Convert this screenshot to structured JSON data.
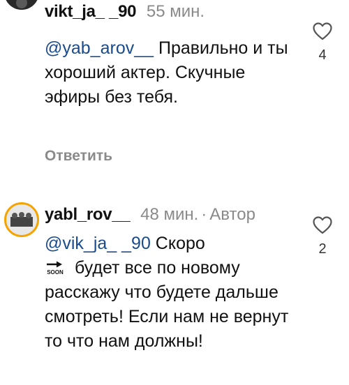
{
  "comments": [
    {
      "username": "vikt_ja_ _90",
      "time": "55 мин.",
      "mention": "@yab_arov__",
      "text": " Правильно и ты хороший актер. Скучные эфиры без тебя.",
      "reply_label": "Ответить",
      "likes": "4"
    },
    {
      "username": "yabl_rov__",
      "time": "48 мин.",
      "separator": "·",
      "author_label": "Автор",
      "mention": "@vik_ja_ _90",
      "text_part1": " Скоро ",
      "soon_label": "SOON",
      "text_part2": " будет все по новому расскажу что будете дальше смотреть! Если нам не вернут то что нам должны!",
      "likes": "2"
    }
  ],
  "icons": {
    "like": "heart-outline-icon",
    "soon": "soon-arrow-icon"
  },
  "colors": {
    "mention": "#1a4b8c",
    "muted": "#8a8a8a",
    "story_ring": "#f5a300"
  }
}
